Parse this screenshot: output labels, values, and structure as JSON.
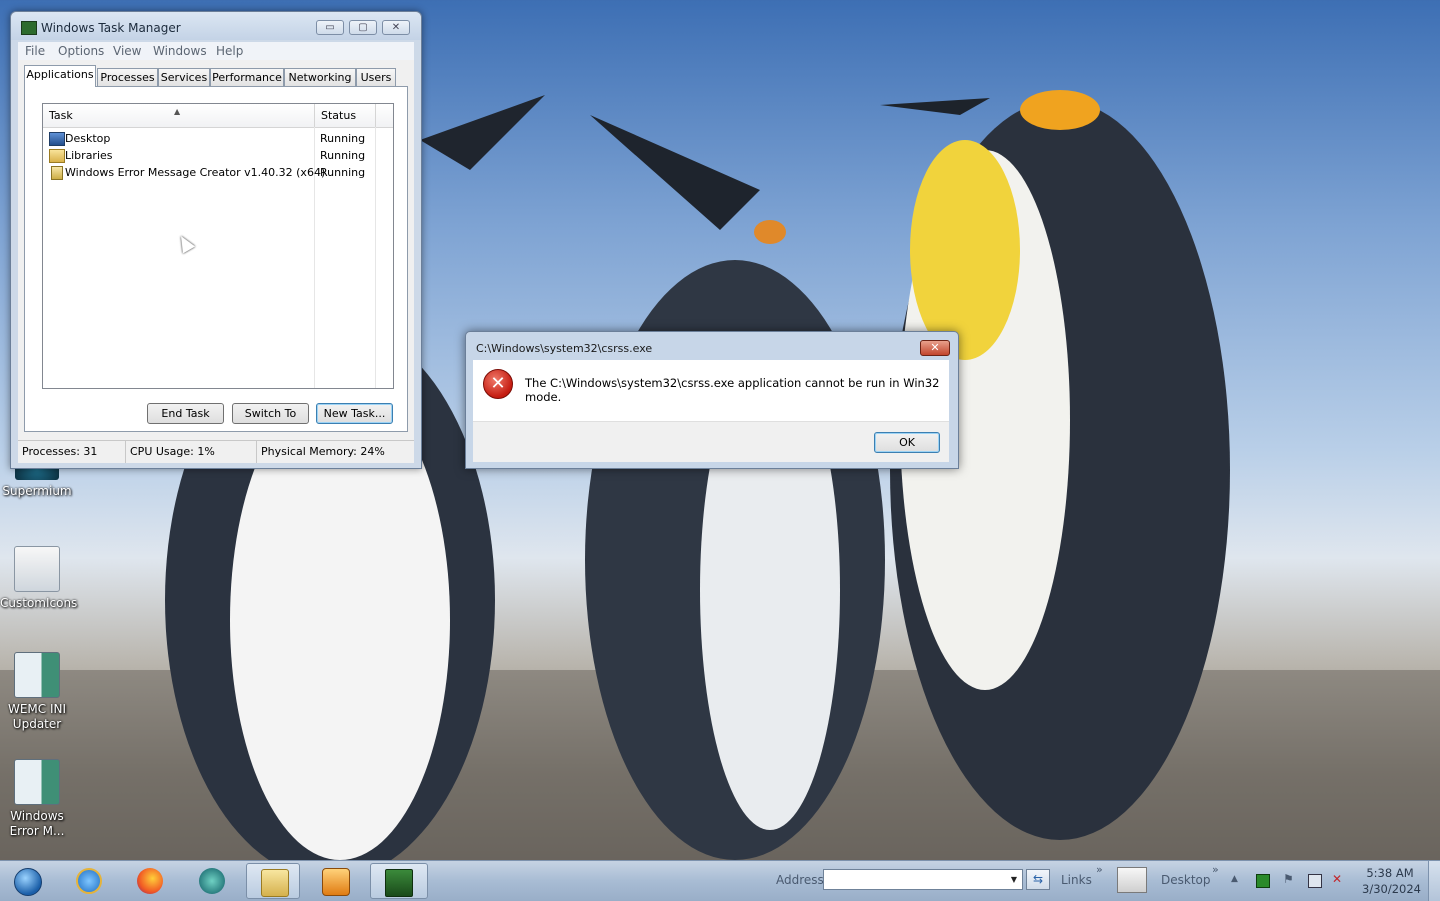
{
  "task_manager": {
    "title": "Windows Task Manager",
    "caption_buttons": {
      "minimize": "▭",
      "maximize": "▢",
      "close": "✕"
    },
    "menu": [
      "File",
      "Options",
      "View",
      "Windows",
      "Help"
    ],
    "tabs": [
      "Applications",
      "Processes",
      "Services",
      "Performance",
      "Networking",
      "Users"
    ],
    "active_tab": "Applications",
    "columns": {
      "task": "Task",
      "status": "Status"
    },
    "rows": [
      {
        "name": "Desktop",
        "status": "Running",
        "icon": "desktop-icon"
      },
      {
        "name": "Libraries",
        "status": "Running",
        "icon": "folder-icon"
      },
      {
        "name": "Windows Error Message Creator v1.40.32 (x64)",
        "status": "Running",
        "icon": "app-icon"
      }
    ],
    "buttons": {
      "end_task": "End Task",
      "switch_to": "Switch To",
      "new_task": "New Task..."
    },
    "status": {
      "processes": "Processes: 31",
      "cpu": "CPU Usage: 1%",
      "memory": "Physical Memory: 24%"
    }
  },
  "error_dialog": {
    "title": "C:\\Windows\\system32\\csrss.exe",
    "message": "The C:\\Windows\\system32\\csrss.exe application cannot be run in Win32 mode.",
    "close_glyph": "✕",
    "icon_glyph": "✕",
    "ok_label": "OK",
    "icon": "error-icon"
  },
  "desktop_icons": [
    {
      "label": "Supermium",
      "icon": "supermium-icon"
    },
    {
      "label": "CustomIcons",
      "icon": "custom-icons-icon"
    },
    {
      "label": "WEMC INI Updater",
      "icon": "wemc-ini-icon"
    },
    {
      "label": "Windows Error M...",
      "icon": "windows-error-icon"
    }
  ],
  "taskbar": {
    "pinned": [
      "start-orb-icon",
      "internet-explorer-icon",
      "firefox-icon",
      "supermium-icon",
      "explorer-icon",
      "media-player-icon",
      "task-manager-icon"
    ],
    "address_label": "Address",
    "links_label": "Links",
    "desktop_label": "Desktop",
    "chevron": "»",
    "clock_time": "5:38 AM",
    "clock_date": "3/30/2024"
  },
  "colors": {
    "accent": "#3c7fb1",
    "error_red": "#c41b10",
    "taskbar": "#a8bcd4"
  }
}
